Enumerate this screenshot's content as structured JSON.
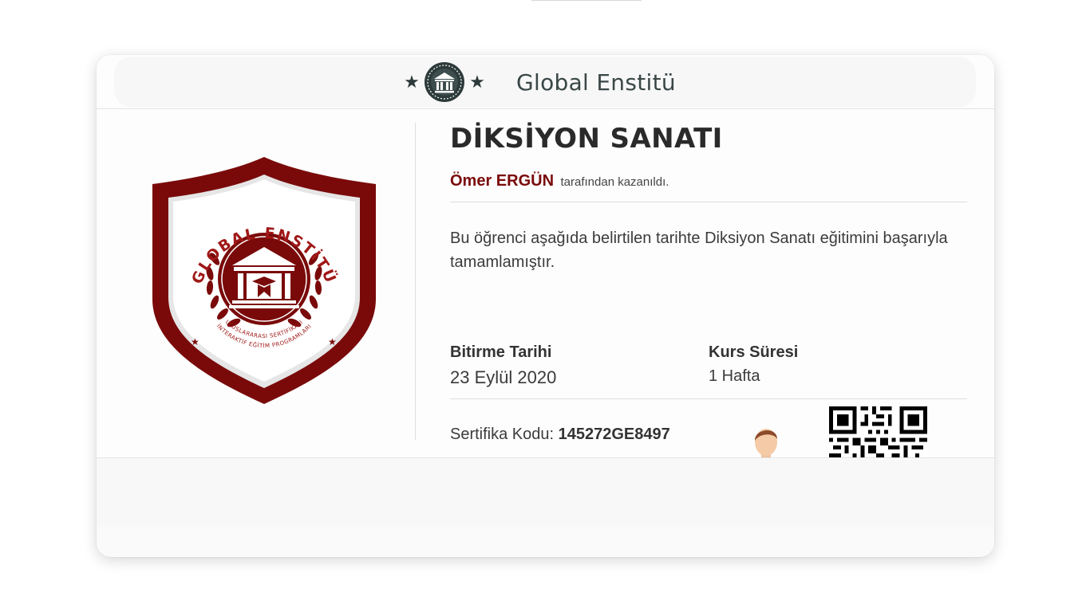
{
  "header": {
    "brand_name": "Global Enstitü",
    "icons": [
      "star-icon",
      "institute-emblem",
      "star-icon"
    ]
  },
  "badge": {
    "arc_text": "GLOBAL ENSTİTÜ",
    "subtitle_line1": "ULUSLARARASI SERTİFİKALI",
    "subtitle_line2": "İNTERAKTİF EĞİTİM PROGRAMLARI",
    "colors": {
      "primary": "#7a0a0a",
      "accent": "#ffffff"
    }
  },
  "certificate": {
    "course_title": "DİKSİYON SANATI",
    "student_name": "Ömer ERGÜN",
    "earned_by_text": "tarafından kazanıldı.",
    "description": "Bu öğrenci aşağıda belirtilen tarihte Diksiyon Sanatı eğitimini başarıyla tamamlamıştır.",
    "completion_label": "Bitirme Tarihi",
    "completion_date": "23 Eylül 2020",
    "duration_label": "Kurs Süresi",
    "duration_value": "1 Hafta",
    "code_label": "Sertifika Kodu:",
    "code_value": "145272GE8497",
    "images": [
      "speaker-illustration",
      "qr-code"
    ]
  }
}
